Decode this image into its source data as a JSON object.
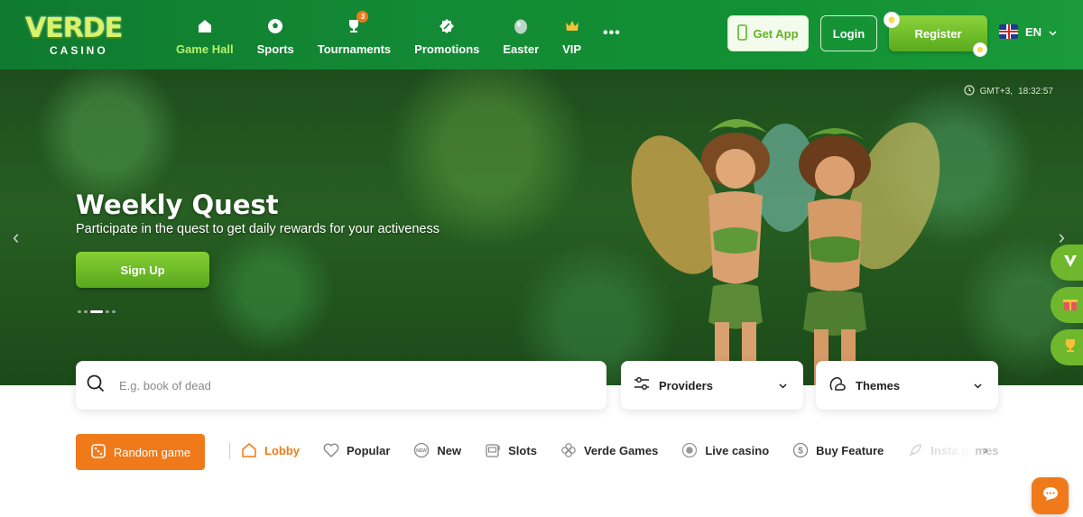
{
  "brand": {
    "logo_word": "VERDE",
    "logo_sub": "CASINO"
  },
  "nav": {
    "items": [
      {
        "label": "Game Hall",
        "icon": "home-icon",
        "active": true
      },
      {
        "label": "Sports",
        "icon": "soccer-ball-icon"
      },
      {
        "label": "Tournaments",
        "icon": "trophy-icon",
        "badge": "3"
      },
      {
        "label": "Promotions",
        "icon": "percent-badge-icon"
      },
      {
        "label": "Easter",
        "icon": "easter-egg-icon"
      },
      {
        "label": "VIP",
        "icon": "crown-icon"
      }
    ],
    "more": "•••"
  },
  "header_actions": {
    "get_app": "Get App",
    "login": "Login",
    "register": "Register",
    "language": "EN"
  },
  "hero": {
    "clock_zone": "GMT+3,",
    "clock_time": "18:32:57",
    "title": "Weekly Quest",
    "subtitle": "Participate in the quest to get daily rewards for your activeness",
    "cta": "Sign Up",
    "slide_count": 5,
    "active_slide": 3
  },
  "search": {
    "placeholder": "E.g. book of dead"
  },
  "filters": {
    "providers": "Providers",
    "themes": "Themes"
  },
  "categories": {
    "random": "Random game",
    "items": [
      {
        "label": "Lobby",
        "icon": "home-outline-icon",
        "active": true
      },
      {
        "label": "Popular",
        "icon": "heart-icon"
      },
      {
        "label": "New",
        "icon": "new-badge-icon"
      },
      {
        "label": "Slots",
        "icon": "slot-machine-icon"
      },
      {
        "label": "Verde Games",
        "icon": "clover-icon"
      },
      {
        "label": "Live casino",
        "icon": "live-dot-icon"
      },
      {
        "label": "Buy Feature",
        "icon": "dollar-coin-icon"
      },
      {
        "label": "Insta games",
        "icon": "rocket-icon"
      }
    ]
  },
  "colors": {
    "header_green": "#138a35",
    "accent_green": "#6fb82d",
    "accent_orange": "#f07a1a"
  }
}
